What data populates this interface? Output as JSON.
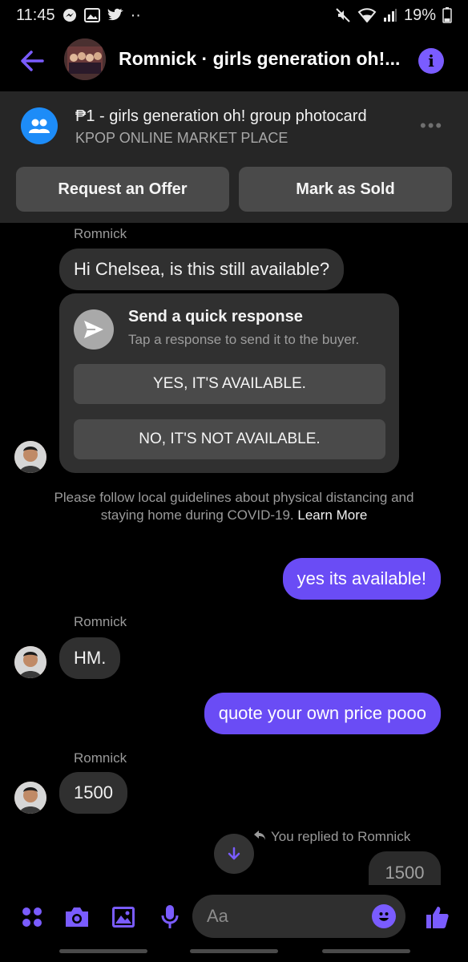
{
  "status_bar": {
    "time": "11:45",
    "battery": "19%",
    "dots": "··"
  },
  "header": {
    "title": "Romnick · girls generation oh!..."
  },
  "listing": {
    "title": "₱1 - girls generation oh! group photocard",
    "group": "KPOP ONLINE MARKET PLACE",
    "more": "•••",
    "offer_label": "Request an Offer",
    "sold_label": "Mark as Sold"
  },
  "chat": {
    "sender_name": "Romnick",
    "first_message": "Hi Chelsea, is this still available?",
    "quick_response": {
      "title": "Send a quick response",
      "subtitle": "Tap a response to send it to the buyer.",
      "yes_label": "YES, IT'S AVAILABLE.",
      "no_label": "NO, IT'S NOT AVAILABLE."
    },
    "notice_text": "Please follow local guidelines about physical distancing and staying home during COVID-19.",
    "notice_link": "Learn More",
    "messages": {
      "out_1": "yes its available!",
      "in_1": "HM.",
      "out_2": "quote your own price pooo",
      "in_2": "1500"
    },
    "replied_label": "You replied to Romnick",
    "reply_preview": "1500"
  },
  "composer": {
    "placeholder": "Aa"
  },
  "colors": {
    "accent": "#6a4cf5",
    "info": "#7a5cff",
    "group_icon": "#1d8cf8"
  },
  "icons": [
    "back-arrow-icon",
    "info-icon",
    "group-icon",
    "more-icon",
    "send-icon",
    "reply-icon",
    "arrow-down-icon",
    "apps-icon",
    "camera-icon",
    "image-icon",
    "microphone-icon",
    "emoji-icon",
    "thumbs-up-icon"
  ]
}
